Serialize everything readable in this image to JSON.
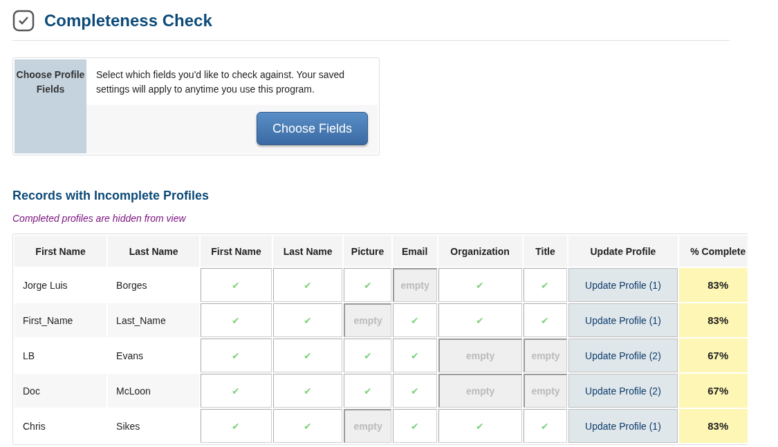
{
  "title": "Completeness Check",
  "choose_panel": {
    "label": "Choose Profile Fields",
    "description": "Select which fields you'd like to check against. Your saved settings will apply to anytime you use this program.",
    "button": "Choose Fields"
  },
  "records": {
    "heading": "Records with Incomplete Profiles",
    "note": "Completed profiles are hidden from view",
    "columns": [
      "First Name",
      "Last Name",
      "First Name",
      "Last Name",
      "Picture",
      "Email",
      "Organization",
      "Title",
      "Update Profile",
      "% Complete"
    ],
    "rows": [
      {
        "first_name": "Jorge Luis",
        "last_name": "Borges",
        "fields": [
          {
            "kind": "check",
            "text": "✔"
          },
          {
            "kind": "check",
            "text": "✔"
          },
          {
            "kind": "check",
            "text": "✔"
          },
          {
            "kind": "empty",
            "text": "empty"
          },
          {
            "kind": "check",
            "text": "✔"
          },
          {
            "kind": "check",
            "text": "✔"
          }
        ],
        "update": "Update Profile (1)",
        "complete": "83%"
      },
      {
        "first_name": "First_Name",
        "last_name": "Last_Name",
        "fields": [
          {
            "kind": "check",
            "text": "✔"
          },
          {
            "kind": "check",
            "text": "✔"
          },
          {
            "kind": "empty",
            "text": "empty"
          },
          {
            "kind": "check",
            "text": "✔"
          },
          {
            "kind": "check",
            "text": "✔"
          },
          {
            "kind": "check",
            "text": "✔"
          }
        ],
        "update": "Update Profile (1)",
        "complete": "83%"
      },
      {
        "first_name": "LB",
        "last_name": "Evans",
        "fields": [
          {
            "kind": "check",
            "text": "✔"
          },
          {
            "kind": "check",
            "text": "✔"
          },
          {
            "kind": "check",
            "text": "✔"
          },
          {
            "kind": "check",
            "text": "✔"
          },
          {
            "kind": "empty",
            "text": "empty"
          },
          {
            "kind": "empty",
            "text": "empty"
          }
        ],
        "update": "Update Profile (2)",
        "complete": "67%"
      },
      {
        "first_name": "Doc",
        "last_name": "McLoon",
        "fields": [
          {
            "kind": "check",
            "text": "✔"
          },
          {
            "kind": "check",
            "text": "✔"
          },
          {
            "kind": "check",
            "text": "✔"
          },
          {
            "kind": "check",
            "text": "✔"
          },
          {
            "kind": "empty",
            "text": "empty"
          },
          {
            "kind": "empty",
            "text": "empty"
          }
        ],
        "update": "Update Profile (2)",
        "complete": "67%"
      },
      {
        "first_name": "Chris",
        "last_name": "Sikes",
        "fields": [
          {
            "kind": "check",
            "text": "✔"
          },
          {
            "kind": "check",
            "text": "✔"
          },
          {
            "kind": "empty",
            "text": "empty"
          },
          {
            "kind": "check",
            "text": "✔"
          },
          {
            "kind": "check",
            "text": "✔"
          },
          {
            "kind": "check",
            "text": "✔"
          }
        ],
        "update": "Update Profile (1)",
        "complete": "83%"
      }
    ]
  }
}
